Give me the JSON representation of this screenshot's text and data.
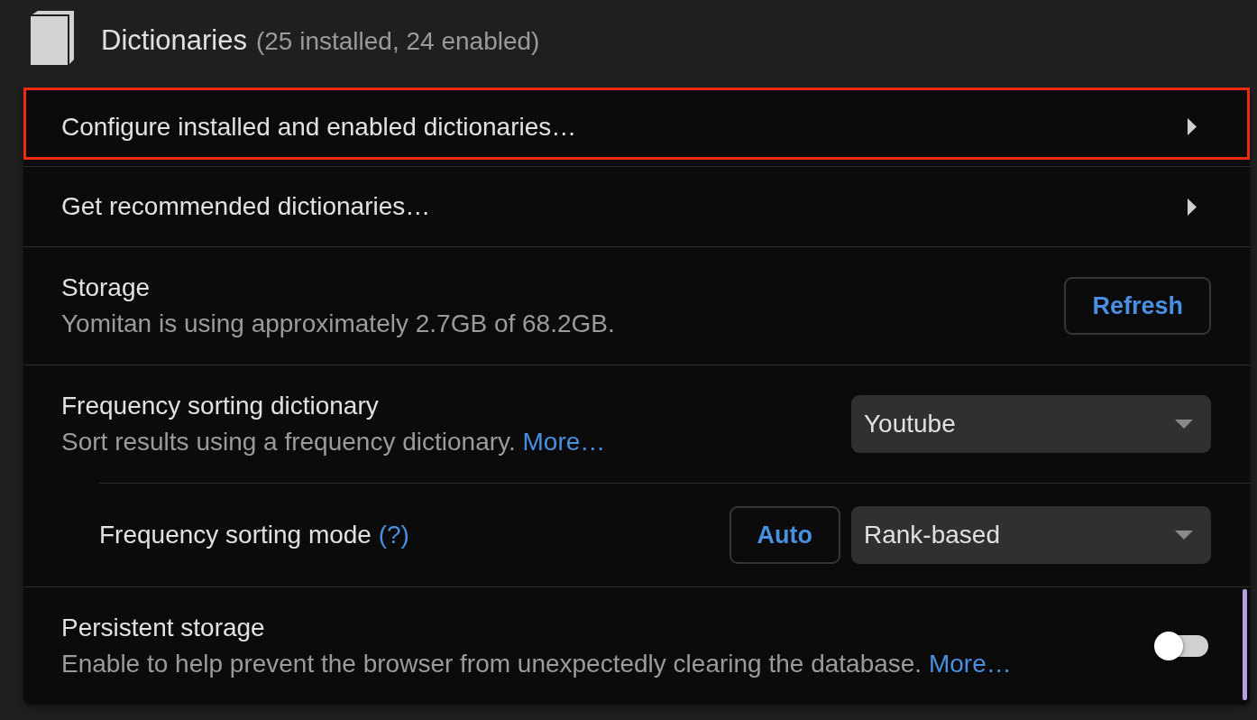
{
  "header": {
    "title": "Dictionaries",
    "subtitle": "(25 installed, 24 enabled)"
  },
  "rows": [
    {
      "kind": "link",
      "label": "Configure installed and enabled dictionaries…",
      "outlined": true,
      "accented": false
    },
    {
      "kind": "link",
      "label": "Get recommended dictionaries…",
      "outlined": false,
      "accented": false
    },
    {
      "kind": "button",
      "label": "Storage",
      "description": "Yomitan is using approximately 2.7GB of 68.2GB.",
      "button": "Refresh",
      "outlined": false,
      "accented": false
    },
    {
      "kind": "select",
      "label": "Frequency sorting dictionary",
      "description": "Sort results using a frequency dictionary.",
      "link": "More…",
      "value": "Youtube",
      "outlined": false,
      "accented": false,
      "children": [
        {
          "kind": "select",
          "label": "Frequency sorting mode",
          "help": "(?)",
          "button": "Auto",
          "value": "Rank-based",
          "outlined": false,
          "accented": false
        }
      ]
    },
    {
      "kind": "toggle",
      "label": "Persistent storage",
      "description": "Enable to help prevent the browser from unexpectedly clearing the database.",
      "link": "More…",
      "on": false,
      "outlined": false,
      "accented": true
    }
  ]
}
